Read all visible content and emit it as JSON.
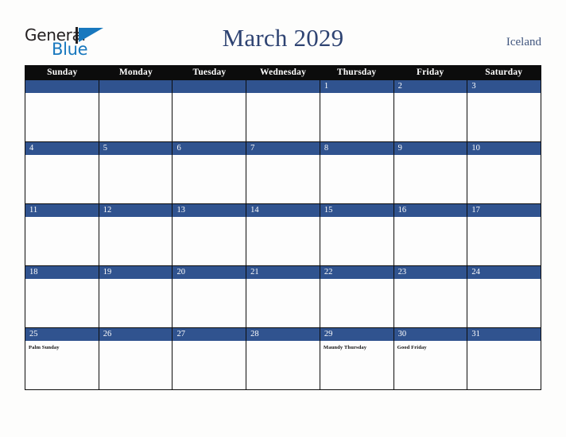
{
  "brand": {
    "name_part1": "General",
    "name_part2": "Blue",
    "triangle_color": "#1878be",
    "text_color": "#231f20"
  },
  "header": {
    "title": "March 2029",
    "country": "Iceland",
    "title_color": "#2e4372"
  },
  "colors": {
    "header_row_bg": "#0c0c0c",
    "date_bar_bg": "#30538f",
    "cell_bg": "#fdfdfd",
    "border": "#0d0d0d",
    "page_bg": "#fdfdfc"
  },
  "calendar": {
    "weekday_headers": [
      "Sunday",
      "Monday",
      "Tuesday",
      "Wednesday",
      "Thursday",
      "Friday",
      "Saturday"
    ],
    "weeks": [
      [
        {
          "day": "",
          "events": []
        },
        {
          "day": "",
          "events": []
        },
        {
          "day": "",
          "events": []
        },
        {
          "day": "",
          "events": []
        },
        {
          "day": "1",
          "events": []
        },
        {
          "day": "2",
          "events": []
        },
        {
          "day": "3",
          "events": []
        }
      ],
      [
        {
          "day": "4",
          "events": []
        },
        {
          "day": "5",
          "events": []
        },
        {
          "day": "6",
          "events": []
        },
        {
          "day": "7",
          "events": []
        },
        {
          "day": "8",
          "events": []
        },
        {
          "day": "9",
          "events": []
        },
        {
          "day": "10",
          "events": []
        }
      ],
      [
        {
          "day": "11",
          "events": []
        },
        {
          "day": "12",
          "events": []
        },
        {
          "day": "13",
          "events": []
        },
        {
          "day": "14",
          "events": []
        },
        {
          "day": "15",
          "events": []
        },
        {
          "day": "16",
          "events": []
        },
        {
          "day": "17",
          "events": []
        }
      ],
      [
        {
          "day": "18",
          "events": []
        },
        {
          "day": "19",
          "events": []
        },
        {
          "day": "20",
          "events": []
        },
        {
          "day": "21",
          "events": []
        },
        {
          "day": "22",
          "events": []
        },
        {
          "day": "23",
          "events": []
        },
        {
          "day": "24",
          "events": []
        }
      ],
      [
        {
          "day": "25",
          "events": [
            "Palm Sunday"
          ]
        },
        {
          "day": "26",
          "events": []
        },
        {
          "day": "27",
          "events": []
        },
        {
          "day": "28",
          "events": []
        },
        {
          "day": "29",
          "events": [
            "Maundy Thursday"
          ]
        },
        {
          "day": "30",
          "events": [
            "Good Friday"
          ]
        },
        {
          "day": "31",
          "events": []
        }
      ]
    ]
  }
}
